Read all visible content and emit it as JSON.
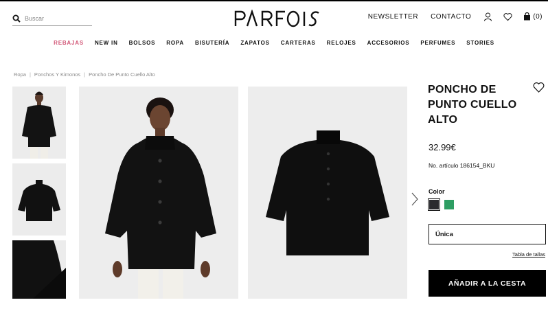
{
  "header": {
    "search_placeholder": "Buscar",
    "brand": "PARFOIS",
    "newsletter": "NEWSLETTER",
    "contact": "CONTACTO",
    "cart_count": "(0)"
  },
  "nav": {
    "items": [
      "REBAJAS",
      "NEW IN",
      "BOLSOS",
      "ROPA",
      "BISUTERÍA",
      "ZAPATOS",
      "CARTERAS",
      "RELOJES",
      "ACCESORIOS",
      "PERFUMES",
      "STORIES"
    ],
    "highlight_color": "#d25878"
  },
  "breadcrumb": [
    "Ropa",
    "Ponchos Y Kimonos",
    "Poncho De Punto Cuello Alto"
  ],
  "product": {
    "title": "PONCHO DE PUNTO CUELLO ALTO",
    "price": "32.99€",
    "reference": "No. artículo 186154_BKU",
    "color_label": "Color",
    "colors": [
      {
        "name": "black",
        "hex": "#2a2a2e",
        "selected": true
      },
      {
        "name": "green",
        "hex": "#2e9e63",
        "selected": false
      }
    ],
    "size": "Única",
    "size_table": "Tabla de tallas",
    "add_to_cart": "AÑADIR A LA CESTA"
  },
  "icons": {
    "search": "search-icon",
    "user": "user-icon",
    "wishlist": "heart-icon",
    "cart": "bag-icon",
    "next": "chevron-right-icon"
  }
}
